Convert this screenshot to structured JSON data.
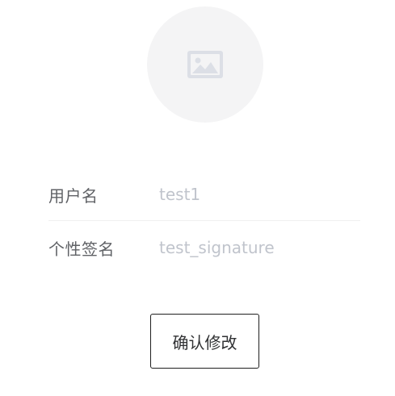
{
  "avatar": {
    "icon": "image-placeholder-icon"
  },
  "form": {
    "username": {
      "label": "用户名",
      "value": "",
      "placeholder": "test1"
    },
    "signature": {
      "label": "个性签名",
      "value": "",
      "placeholder": "test_signature"
    }
  },
  "actions": {
    "confirm_label": "确认修改"
  },
  "colors": {
    "avatar_bg": "#f4f4f5",
    "icon": "#dcdfe6",
    "label_text": "#606266",
    "placeholder_text": "#c0c4cc",
    "button_border": "#1f1f1f"
  }
}
